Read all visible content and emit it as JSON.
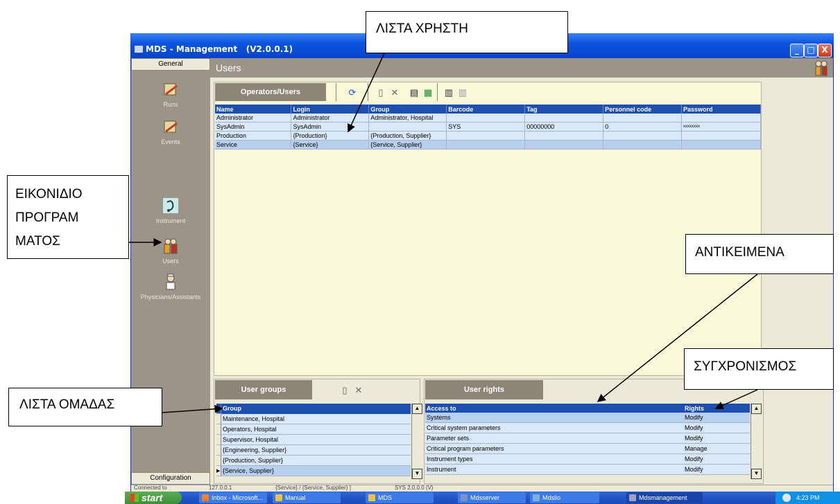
{
  "window": {
    "title": "MDS - Management",
    "version": "(V2.0.0.1)",
    "minimize": "_",
    "maximize": "□",
    "close": "X"
  },
  "nav": {
    "header": "General",
    "footer": "Configuration",
    "items": [
      {
        "label": "Runs",
        "icon": "runs-icon"
      },
      {
        "label": "Events",
        "icon": "events-icon"
      },
      {
        "label": "Instrument",
        "icon": "instrument-icon"
      },
      {
        "label": "Users",
        "icon": "users-icon"
      },
      {
        "label": "Physicians/Assistants",
        "icon": "physicians-icon"
      }
    ]
  },
  "page": {
    "title": "Users"
  },
  "operators": {
    "tab": "Operators/Users",
    "columns": [
      "Name",
      "Login",
      "Group",
      "Barcode",
      "Tag",
      "Personnel code",
      "Password"
    ],
    "rows": [
      [
        "Administrator",
        "Administrator",
        "Administrator, Hospital",
        "",
        "",
        "",
        ""
      ],
      [
        "SysAdmin",
        "SysAdmin",
        "",
        "SYS",
        "00000000",
        "0",
        "xxxxxxxx"
      ],
      [
        "Production",
        "{Production}",
        "{Production, Supplier}",
        "",
        "",
        "",
        ""
      ],
      [
        "Service",
        "{Service}",
        "{Service, Supplier}",
        "",
        "",
        "",
        ""
      ]
    ]
  },
  "groups": {
    "tab": "User groups",
    "column": "Group",
    "rows": [
      "Maintenance, Hospital",
      "Operators, Hospital",
      "Supervisor, Hospital",
      "{Engineering, Supplier}",
      "{Production, Supplier}",
      "{Service, Supplier}"
    ]
  },
  "rights": {
    "tab": "User rights",
    "columns": [
      "Access to",
      "Rights"
    ],
    "rows": [
      [
        "Systems",
        "Modify"
      ],
      [
        "Critical system parameters",
        "Modify"
      ],
      [
        "Parameter sets",
        "Modify"
      ],
      [
        "Critical program parameters",
        "Manage"
      ],
      [
        "Instrument types",
        "Modify"
      ],
      [
        "Instrument",
        "Modify"
      ]
    ]
  },
  "statusbar": {
    "left": "Connected to",
    "ip": "127.0.0.1",
    "user": "{Service} / {Service, Supplier} ]",
    "db": "SYS 2.0.0.0 (V)"
  },
  "taskbar": {
    "start": "start",
    "tasks": [
      "Inbox - Microsoft...",
      "Manual",
      "MDS",
      "Mdsserver",
      "Mdslio",
      "Mdsmanagement"
    ],
    "clock": "4:23 PM"
  },
  "annotations": {
    "user_list": "ΛΙΣΤΑ ΧΡΗΣΤΗ",
    "program_icon": [
      "ΕΙΚΟΝΙΔΙΟ",
      "ΠΡΟΓΡΑΜ",
      "ΜΑΤΟΣ"
    ],
    "objects": "ΑΝΤΙΚΕΙΜΕΝΑ",
    "sync": "ΣΥΓΧΡΟΝΙΣΜΟΣ",
    "group_list": "ΛΙΣΤΑ ΟΜΑΔΑΣ"
  },
  "colors": {
    "titlebar": "#0a55e0",
    "table_header": "#1c4fb0",
    "row_bg": "#d8e8f8",
    "panel_bg": "#f8f7d8",
    "nav_bg": "#9c9488"
  }
}
